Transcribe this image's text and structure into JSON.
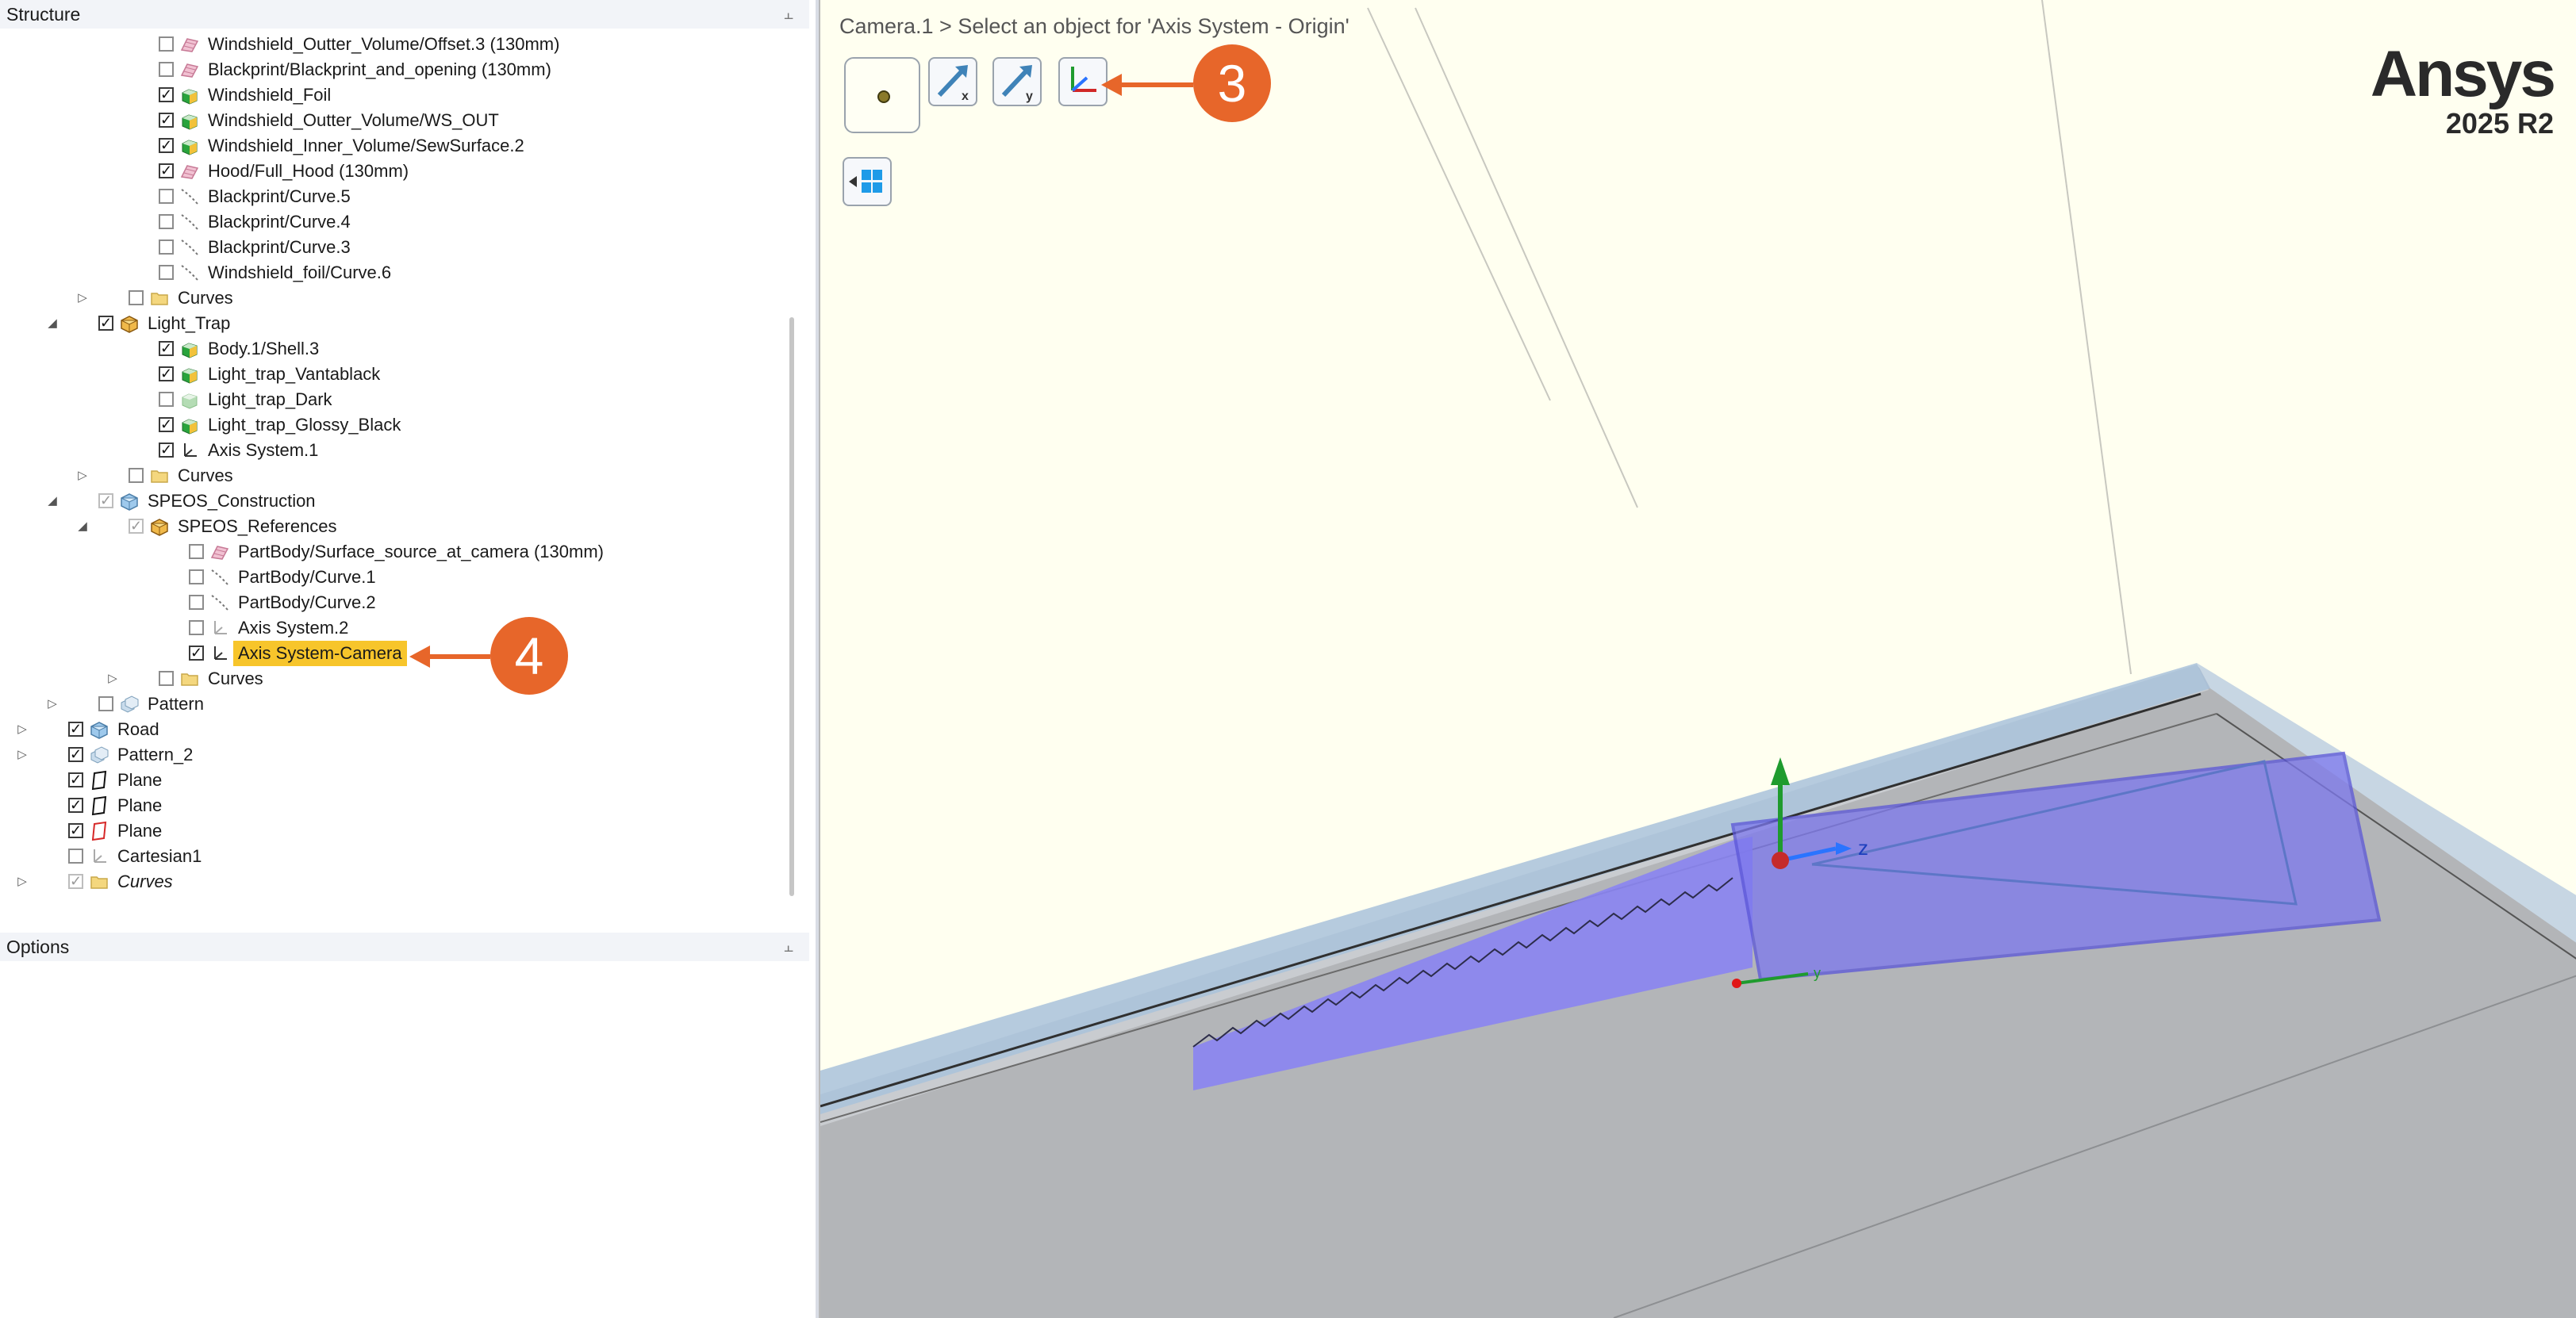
{
  "panels": {
    "structure_title": "Structure",
    "options_title": "Options",
    "pin_glyph": "⫠"
  },
  "tree": [
    {
      "label": "Windshield_Outter_Volume/Offset.3 (130mm)",
      "level": 4,
      "checked": false,
      "icon": "surface-pink-icon",
      "expander": ""
    },
    {
      "label": "Blackprint/Blackprint_and_opening (130mm)",
      "level": 4,
      "checked": false,
      "icon": "surface-pink-icon",
      "expander": ""
    },
    {
      "label": "Windshield_Foil",
      "level": 4,
      "checked": true,
      "icon": "solid-green-icon",
      "expander": ""
    },
    {
      "label": "Windshield_Outter_Volume/WS_OUT",
      "level": 4,
      "checked": true,
      "icon": "solid-green-icon",
      "expander": ""
    },
    {
      "label": "Windshield_Inner_Volume/SewSurface.2",
      "level": 4,
      "checked": true,
      "icon": "solid-green-icon",
      "expander": ""
    },
    {
      "label": "Hood/Full_Hood (130mm)",
      "level": 4,
      "checked": true,
      "icon": "surface-pink-icon",
      "expander": ""
    },
    {
      "label": "Blackprint/Curve.5",
      "level": 4,
      "checked": false,
      "icon": "curve-icon",
      "expander": ""
    },
    {
      "label": "Blackprint/Curve.4",
      "level": 4,
      "checked": false,
      "icon": "curve-icon",
      "expander": ""
    },
    {
      "label": "Blackprint/Curve.3",
      "level": 4,
      "checked": false,
      "icon": "curve-icon",
      "expander": ""
    },
    {
      "label": "Windshield_foil/Curve.6",
      "level": 4,
      "checked": false,
      "icon": "curve-icon",
      "expander": ""
    },
    {
      "label": "Curves",
      "level": 3,
      "checked": false,
      "icon": "folder-icon",
      "expander": "▷"
    },
    {
      "label": "Light_Trap",
      "level": 2,
      "checked": true,
      "icon": "component-icon",
      "expander": "◢"
    },
    {
      "label": "Body.1/Shell.3",
      "level": 4,
      "checked": true,
      "icon": "solid-green-icon",
      "expander": ""
    },
    {
      "label": "Light_trap_Vantablack",
      "level": 4,
      "checked": true,
      "icon": "solid-green-icon",
      "expander": ""
    },
    {
      "label": "Light_trap_Dark",
      "level": 4,
      "checked": false,
      "icon": "solid-faded-icon",
      "expander": ""
    },
    {
      "label": "Light_trap_Glossy_Black",
      "level": 4,
      "checked": true,
      "icon": "solid-green-icon",
      "expander": ""
    },
    {
      "label": "Axis System.1",
      "level": 4,
      "checked": true,
      "icon": "axis-system-icon",
      "expander": ""
    },
    {
      "label": "Curves",
      "level": 3,
      "checked": false,
      "icon": "folder-icon",
      "expander": "▷"
    },
    {
      "label": "SPEOS_Construction",
      "level": 2,
      "checked": true,
      "icon": "component-blue-icon",
      "expander": "◢",
      "dim": true
    },
    {
      "label": "SPEOS_References",
      "level": 3,
      "checked": true,
      "icon": "component-icon",
      "expander": "◢",
      "dim": true
    },
    {
      "label": "PartBody/Surface_source_at_camera (130mm)",
      "level": 5,
      "checked": false,
      "icon": "surface-pink-icon",
      "expander": ""
    },
    {
      "label": "PartBody/Curve.1",
      "level": 5,
      "checked": false,
      "icon": "curve-icon",
      "expander": ""
    },
    {
      "label": "PartBody/Curve.2",
      "level": 5,
      "checked": false,
      "icon": "curve-icon",
      "expander": ""
    },
    {
      "label": "Axis System.2",
      "level": 5,
      "checked": false,
      "icon": "axis-system-faded-icon",
      "expander": ""
    },
    {
      "label": "Axis System-Camera",
      "level": 5,
      "checked": true,
      "icon": "axis-system-icon",
      "expander": "",
      "selected": true
    },
    {
      "label": "Curves",
      "level": 4,
      "checked": false,
      "icon": "folder-icon",
      "expander": "▷"
    },
    {
      "label": "Pattern",
      "level": 2,
      "checked": false,
      "icon": "pattern-icon",
      "expander": "▷"
    },
    {
      "label": "Road",
      "level": 1,
      "checked": true,
      "icon": "component-blue-icon",
      "expander": "▷"
    },
    {
      "label": "Pattern_2",
      "level": 1,
      "checked": true,
      "icon": "pattern-icon",
      "expander": "▷"
    },
    {
      "label": "Plane",
      "level": 1,
      "checked": true,
      "icon": "plane-black-icon",
      "expander": ""
    },
    {
      "label": "Plane",
      "level": 1,
      "checked": true,
      "icon": "plane-black-icon",
      "expander": ""
    },
    {
      "label": "Plane",
      "level": 1,
      "checked": true,
      "icon": "plane-red-icon",
      "expander": ""
    },
    {
      "label": "Cartesian1",
      "level": 1,
      "checked": false,
      "icon": "axis-system-faded-icon",
      "expander": ""
    },
    {
      "label": "Curves",
      "level": 1,
      "checked": true,
      "icon": "folder-icon",
      "expander": "▷",
      "italic": true,
      "dim": true
    }
  ],
  "viewport": {
    "breadcrumb": "Camera.1 > Select an object for 'Axis System - Origin'",
    "brand_name": "Ansys",
    "brand_version": "2025 R2",
    "axis_label_z": "z",
    "axis_label_y": "y",
    "tools": [
      {
        "name": "origin-point-tool",
        "icon": "origin-point-icon"
      },
      {
        "name": "x-direction-tool",
        "icon": "x-arrow-icon"
      },
      {
        "name": "y-direction-tool",
        "icon": "y-arrow-icon"
      },
      {
        "name": "axis-system-tool",
        "icon": "axis-system-icon"
      },
      {
        "name": "split-view-tool",
        "icon": "windows-split-icon"
      }
    ]
  },
  "callouts": {
    "three": "3",
    "four": "4"
  },
  "colors": {
    "viewport_bg": "#fffff0",
    "selection": "#f7c52b",
    "callout": "#e7662a",
    "camera_volume": "#8a84f2",
    "road": "#b3b5b8"
  }
}
